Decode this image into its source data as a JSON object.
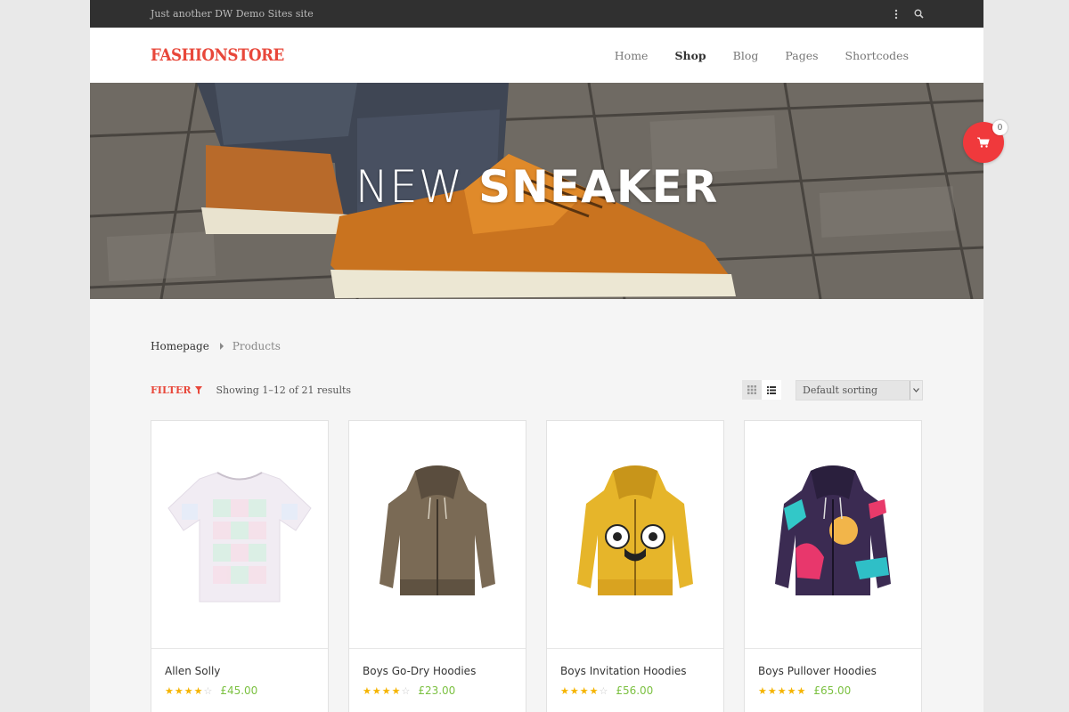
{
  "topbar": {
    "tagline": "Just another DW Demo Sites site"
  },
  "header": {
    "logo": "FASHIONSTORE",
    "nav": [
      {
        "label": "Home"
      },
      {
        "label": "Shop"
      },
      {
        "label": "Blog"
      },
      {
        "label": "Pages"
      },
      {
        "label": "Shortcodes"
      }
    ]
  },
  "hero": {
    "title_thin": "NEW",
    "title_bold": "SNEAKER"
  },
  "breadcrumb": {
    "home": "Homepage",
    "current": "Products"
  },
  "toolbar": {
    "filter_label": "FILTER",
    "result_count": "Showing 1–12 of 21 results",
    "sort_selected": "Default sorting"
  },
  "cart": {
    "count": "0"
  },
  "products": [
    {
      "name": "Allen Solly",
      "price": "£45.00",
      "rating": 4
    },
    {
      "name": "Boys Go-Dry Hoodies",
      "price": "£23.00",
      "rating": 4
    },
    {
      "name": "Boys Invitation Hoodies",
      "price": "£56.00",
      "rating": 4
    },
    {
      "name": "Boys Pullover Hoodies",
      "price": "£65.00",
      "rating": 5
    }
  ],
  "colors": {
    "brand": "#e8473a",
    "topbar": "#303030",
    "price": "#7cc142",
    "star": "#f5b400",
    "cart": "#f0393c"
  }
}
